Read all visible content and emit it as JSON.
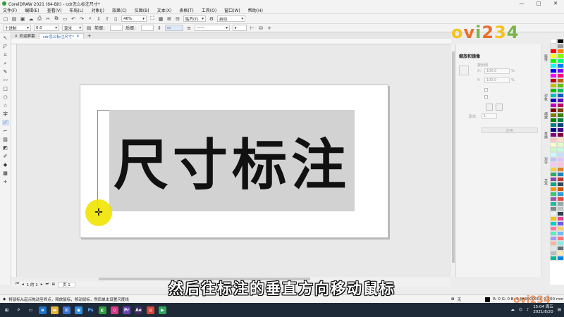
{
  "window": {
    "title": "CorelDRAW 2021 (64-Bit) - cdr怎么标注尺寸*"
  },
  "menu": {
    "items": [
      "文件(F)",
      "编辑(E)",
      "查看(V)",
      "布局(L)",
      "对象(J)",
      "效果(C)",
      "位图(B)",
      "文本(X)",
      "表格(T)",
      "工具(O)",
      "窗口(W)",
      "帮助(H)"
    ]
  },
  "standard_bar": {
    "zoom": "46%",
    "snap": "贴齐(T)",
    "launch": "启动"
  },
  "property_bar": {
    "units_style": "十进制",
    "precision": "0.0",
    "unit": "毫米",
    "prefix_label": "前缀：",
    "suffix_label": "后缀："
  },
  "tabs": {
    "welcome": "欢迎屏幕",
    "document": "cdr怎么标注尺寸*"
  },
  "canvas": {
    "text": "尺寸标注"
  },
  "docker": {
    "title": "缩放和镜像",
    "x_label": "X:",
    "x_value": "100.0",
    "y_label": "Y:",
    "y_value": "100.0",
    "units": "%",
    "proportional": "按比例",
    "copies_label": "副本：",
    "copies_value": "1",
    "apply": "应用"
  },
  "side_tabs": [
    "属性",
    "对象",
    "缩放",
    "变换",
    "对齐",
    "文本"
  ],
  "page_nav": {
    "position": "1 的 1",
    "page_tab": "页 1"
  },
  "status": {
    "hint": "将鼠标从起点拖动至终点，释放鼠标，移动鼠标，然后单击设置尺度线",
    "fill": "无",
    "outline": "R: 0 G: 0 B: 0 (#000000)",
    "outline_width": "0.200 mm"
  },
  "taskbar": {
    "time": "15:04 周五",
    "date": "2021/8/20"
  },
  "subtitle": "然后往标注的垂直方向移动鼠标",
  "watermark": {
    "brand": "ovi234"
  },
  "colors": {
    "highlight": "#f0e400",
    "accent": "#2a5db0"
  }
}
